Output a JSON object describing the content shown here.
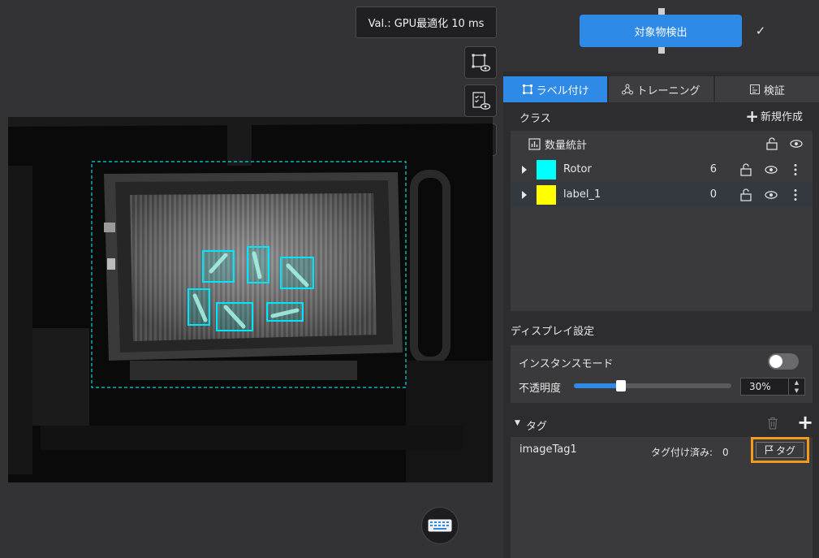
{
  "canvas": {
    "validation_text": "Val.: GPU最適化 10 ms",
    "tools": [
      {
        "icon": "annotation-visibility-icon"
      },
      {
        "icon": "checklist-visibility-icon"
      },
      {
        "icon": "mask-visibility-icon"
      }
    ],
    "keyboard_icon": "keyboard-icon"
  },
  "toolbar": {
    "detect_label": "対象物検出",
    "confirm_icon": "check-icon"
  },
  "tabs": [
    {
      "label": "ラベル付け",
      "icon": "label-icon",
      "active": true
    },
    {
      "label": "トレーニング",
      "icon": "network-icon",
      "active": false
    },
    {
      "label": "検証",
      "icon": "chart-icon",
      "active": false
    }
  ],
  "classes": {
    "title": "クラス",
    "new_label": "新規作成",
    "stats_label": "数量統計",
    "items": [
      {
        "name": "Rotor",
        "count": "6",
        "color": "#00ffff"
      },
      {
        "name": "label_1",
        "count": "0",
        "color": "#ffff00"
      }
    ]
  },
  "display": {
    "title": "ディスプレイ設定",
    "instance_mode_label": "インスタンスモード",
    "instance_mode_on": false,
    "opacity_label": "不透明度",
    "opacity_value": "30%",
    "opacity_fraction": 0.3
  },
  "tags": {
    "title": "タグ",
    "items": [
      {
        "name": "imageTag1",
        "status": "タグ付け済み:　0",
        "button_label": "タグ"
      }
    ]
  },
  "colors": {
    "accent": "#2e8ae6",
    "highlight": "#f29a1d",
    "annotation": "#00ffff"
  }
}
